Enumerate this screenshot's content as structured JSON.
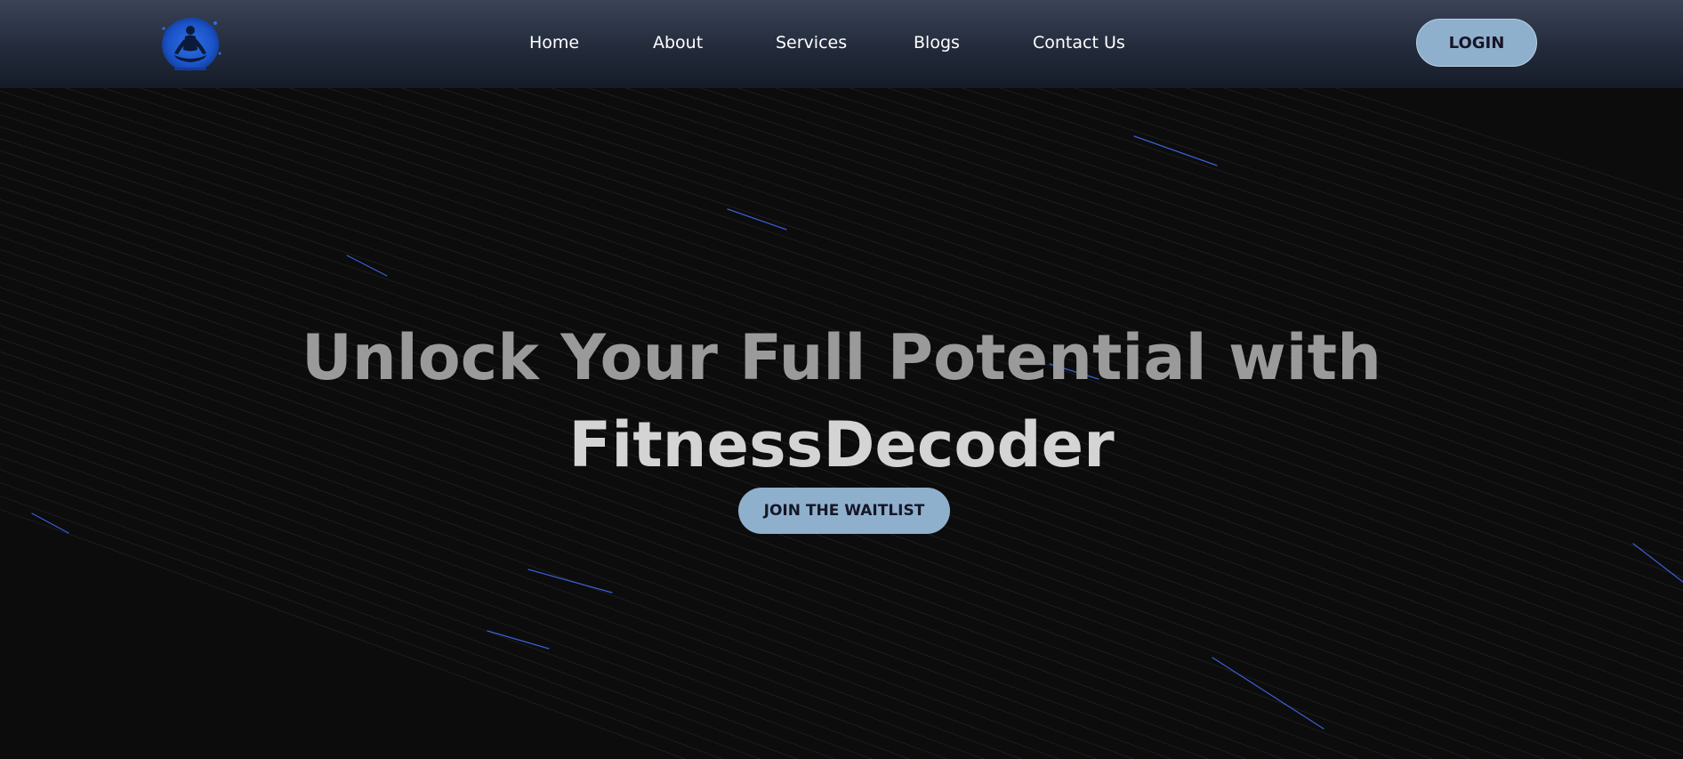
{
  "colors": {
    "header_top": "#3a4457",
    "header_bottom": "#151b28",
    "background": "#0c0c0d",
    "button": "#8fb0cd",
    "button_text": "#161626",
    "title_line1": "#9a9a9a",
    "title_line2": "#d4d4d4",
    "meteor": "#3b5fd6"
  },
  "header": {
    "logo_icon": "meditation-figure-logo",
    "nav": [
      {
        "label": "Home"
      },
      {
        "label": "About"
      },
      {
        "label": "Services"
      },
      {
        "label": "Blogs"
      },
      {
        "label": "Contact Us"
      }
    ],
    "login_label": "LOGIN"
  },
  "hero": {
    "title_line1": "Unlock Your Full Potential with",
    "title_line2": "FitnessDecoder",
    "cta_label": "JOIN THE WAITLIST"
  }
}
